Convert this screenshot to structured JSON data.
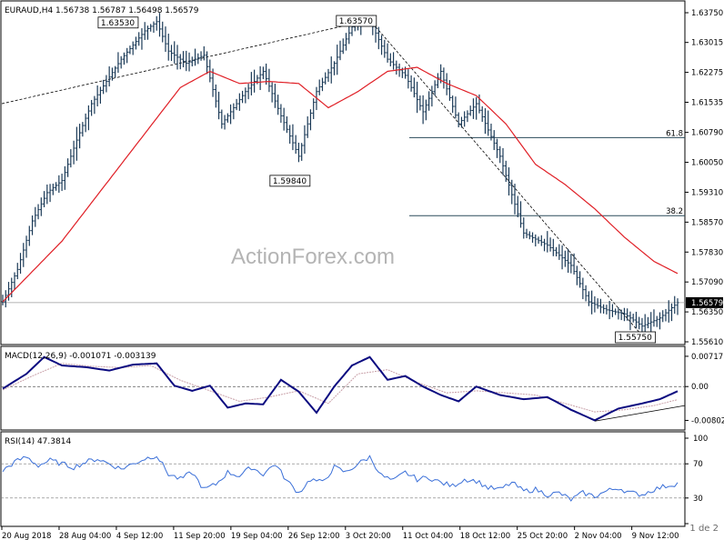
{
  "watermark": "ActionForex.com",
  "page_indicator": "1 de 2",
  "colors": {
    "background": "#ffffff",
    "bar": "#1b3a57",
    "moving_average": "#e01f26",
    "macd_main": "#0b0b80",
    "macd_signal": "#c8a0a8",
    "rsi_line": "#3a6fd8",
    "trendline": "#000000",
    "level_line": "#2a4a5a",
    "price_label_fill": "#000000",
    "price_label_text": "#ffffff",
    "watermark_color": "#b4b4b4"
  },
  "chart_data": [
    {
      "type": "ohlc",
      "title": "EURAUD,H4  1.56738 1.56787 1.56498 1.56579",
      "symbol": "EURAUD",
      "timeframe": "H4",
      "ohlc_header": {
        "open": 1.56738,
        "high": 1.56787,
        "low": 1.56498,
        "close": 1.56579
      },
      "current_price": 1.56579,
      "current_price_label": "1.56579",
      "ylim": [
        1.5561,
        1.6375
      ],
      "y_ticks": [
        "1.63750",
        "1.63015",
        "1.62275",
        "1.61535",
        "1.60790",
        "1.60050",
        "1.59310",
        "1.58570",
        "1.57830",
        "1.57090",
        "1.56350",
        "1.55610"
      ],
      "x_ticks": [
        "20 Aug 2018",
        "28 Aug 04:00",
        "4 Sep 12:00",
        "11 Sep 20:00",
        "19 Sep 04:00",
        "26 Sep 12:00",
        "3 Oct 20:00",
        "11 Oct 04:00",
        "18 Oct 12:00",
        "25 Oct 20:00",
        "2 Nov 04:00",
        "9 Nov 12:00"
      ],
      "swing_labels": [
        {
          "text": "1.63530",
          "date": "4 Sep 12:00",
          "price": 1.6353
        },
        {
          "text": "1.63570",
          "date": "3 Oct 20:00",
          "price": 1.6357
        },
        {
          "text": "1.59840",
          "date": "26 Sep 12:00",
          "price": 1.5984
        },
        {
          "text": "1.55750",
          "date": "9 Nov 12:00",
          "price": 1.5575
        }
      ],
      "fib_levels": [
        {
          "label": "61.8",
          "price": 1.6066
        },
        {
          "label": "38.2",
          "price": 1.5873
        }
      ],
      "series": [
        {
          "kind": "close_path",
          "x_index": [
            0,
            5,
            10,
            15,
            20,
            25,
            30,
            40,
            48,
            52,
            56,
            62,
            68,
            74,
            82,
            88,
            94,
            100,
            106,
            112,
            118,
            124,
            130,
            136,
            142,
            148,
            154,
            160,
            168,
            176,
            184,
            192,
            198,
            204,
            210,
            216,
            222,
            228
          ],
          "close": [
            1.566,
            1.574,
            1.586,
            1.593,
            1.596,
            1.606,
            1.615,
            1.626,
            1.633,
            1.6353,
            1.628,
            1.625,
            1.627,
            1.61,
            1.618,
            1.623,
            1.612,
            1.602,
            1.618,
            1.625,
            1.634,
            1.6357,
            1.626,
            1.622,
            1.613,
            1.623,
            1.61,
            1.615,
            1.602,
            1.583,
            1.58,
            1.575,
            1.566,
            1.564,
            1.563,
            1.56,
            1.562,
            1.5658
          ]
        },
        {
          "kind": "moving_average",
          "x_index": [
            0,
            20,
            40,
            60,
            70,
            80,
            90,
            100,
            110,
            120,
            130,
            140,
            150,
            160,
            170,
            180,
            190,
            200,
            210,
            220,
            228
          ],
          "values": [
            1.566,
            1.581,
            1.6,
            1.619,
            1.623,
            1.62,
            1.6205,
            1.62,
            1.614,
            1.618,
            1.623,
            1.624,
            1.62,
            1.617,
            1.61,
            1.6,
            1.595,
            1.589,
            1.582,
            1.576,
            1.573
          ]
        }
      ]
    },
    {
      "type": "line",
      "title": "MACD(12,26,9) -0.001071 -0.003139",
      "indicator": "MACD",
      "params": "12,26,9",
      "main_value": -0.001071,
      "signal_value": -0.003139,
      "ylim": [
        -0.009,
        0.0078
      ],
      "y_ticks": [
        "0.00717",
        "0.00",
        "-0.00802"
      ],
      "series": [
        {
          "kind": "macd_main",
          "x_index": [
            0,
            8,
            14,
            20,
            28,
            36,
            44,
            52,
            58,
            64,
            70,
            76,
            82,
            88,
            94,
            100,
            106,
            112,
            118,
            124,
            130,
            136,
            142,
            148,
            154,
            160,
            168,
            176,
            184,
            192,
            200,
            208,
            216,
            222,
            228
          ],
          "values": [
            -0.0005,
            0.003,
            0.007,
            0.005,
            0.0046,
            0.0038,
            0.0052,
            0.0055,
            0.0002,
            -0.001,
            0.0002,
            -0.005,
            -0.004,
            -0.0042,
            0.0016,
            -0.0012,
            -0.0062,
            0.0,
            0.005,
            0.007,
            0.0016,
            0.0025,
            0.0,
            -0.002,
            -0.0035,
            0.0,
            -0.002,
            -0.003,
            -0.0025,
            -0.0055,
            -0.008,
            -0.0052,
            -0.004,
            -0.003,
            -0.0011
          ]
        },
        {
          "kind": "macd_signal",
          "x_index": [
            0,
            10,
            20,
            30,
            40,
            50,
            60,
            70,
            80,
            90,
            100,
            110,
            120,
            130,
            140,
            150,
            160,
            170,
            180,
            190,
            200,
            210,
            220,
            228
          ],
          "values": [
            -0.0008,
            0.0025,
            0.0055,
            0.0048,
            0.0045,
            0.005,
            0.0015,
            -0.001,
            -0.0035,
            -0.0025,
            -0.001,
            -0.004,
            0.003,
            0.004,
            0.001,
            -0.0015,
            -0.001,
            -0.0015,
            -0.002,
            -0.004,
            -0.006,
            -0.0055,
            -0.0045,
            -0.0031
          ]
        }
      ]
    },
    {
      "type": "line",
      "title": "RSI(14) 47.3814",
      "indicator": "RSI",
      "params": "14",
      "value": 47.3814,
      "ylim": [
        0,
        100
      ],
      "levels": [
        70,
        30
      ],
      "y_ticks": [
        "100",
        "70",
        "30",
        "0"
      ],
      "series": [
        {
          "kind": "rsi",
          "x_index": [
            0,
            4,
            8,
            12,
            16,
            20,
            24,
            28,
            32,
            36,
            40,
            44,
            48,
            52,
            56,
            60,
            64,
            68,
            72,
            76,
            80,
            84,
            88,
            92,
            96,
            100,
            104,
            108,
            112,
            116,
            120,
            124,
            128,
            132,
            136,
            140,
            144,
            148,
            152,
            156,
            160,
            164,
            168,
            172,
            176,
            180,
            184,
            188,
            192,
            196,
            200,
            204,
            208,
            212,
            216,
            220,
            224,
            228
          ],
          "values": [
            62,
            72,
            78,
            68,
            74,
            70,
            66,
            72,
            76,
            70,
            64,
            70,
            76,
            80,
            58,
            52,
            60,
            40,
            46,
            60,
            56,
            66,
            58,
            70,
            50,
            36,
            52,
            48,
            66,
            60,
            70,
            78,
            56,
            50,
            60,
            52,
            54,
            48,
            44,
            52,
            50,
            42,
            40,
            48,
            38,
            40,
            34,
            36,
            28,
            36,
            32,
            38,
            42,
            36,
            34,
            40,
            44,
            47
          ]
        }
      ]
    }
  ]
}
